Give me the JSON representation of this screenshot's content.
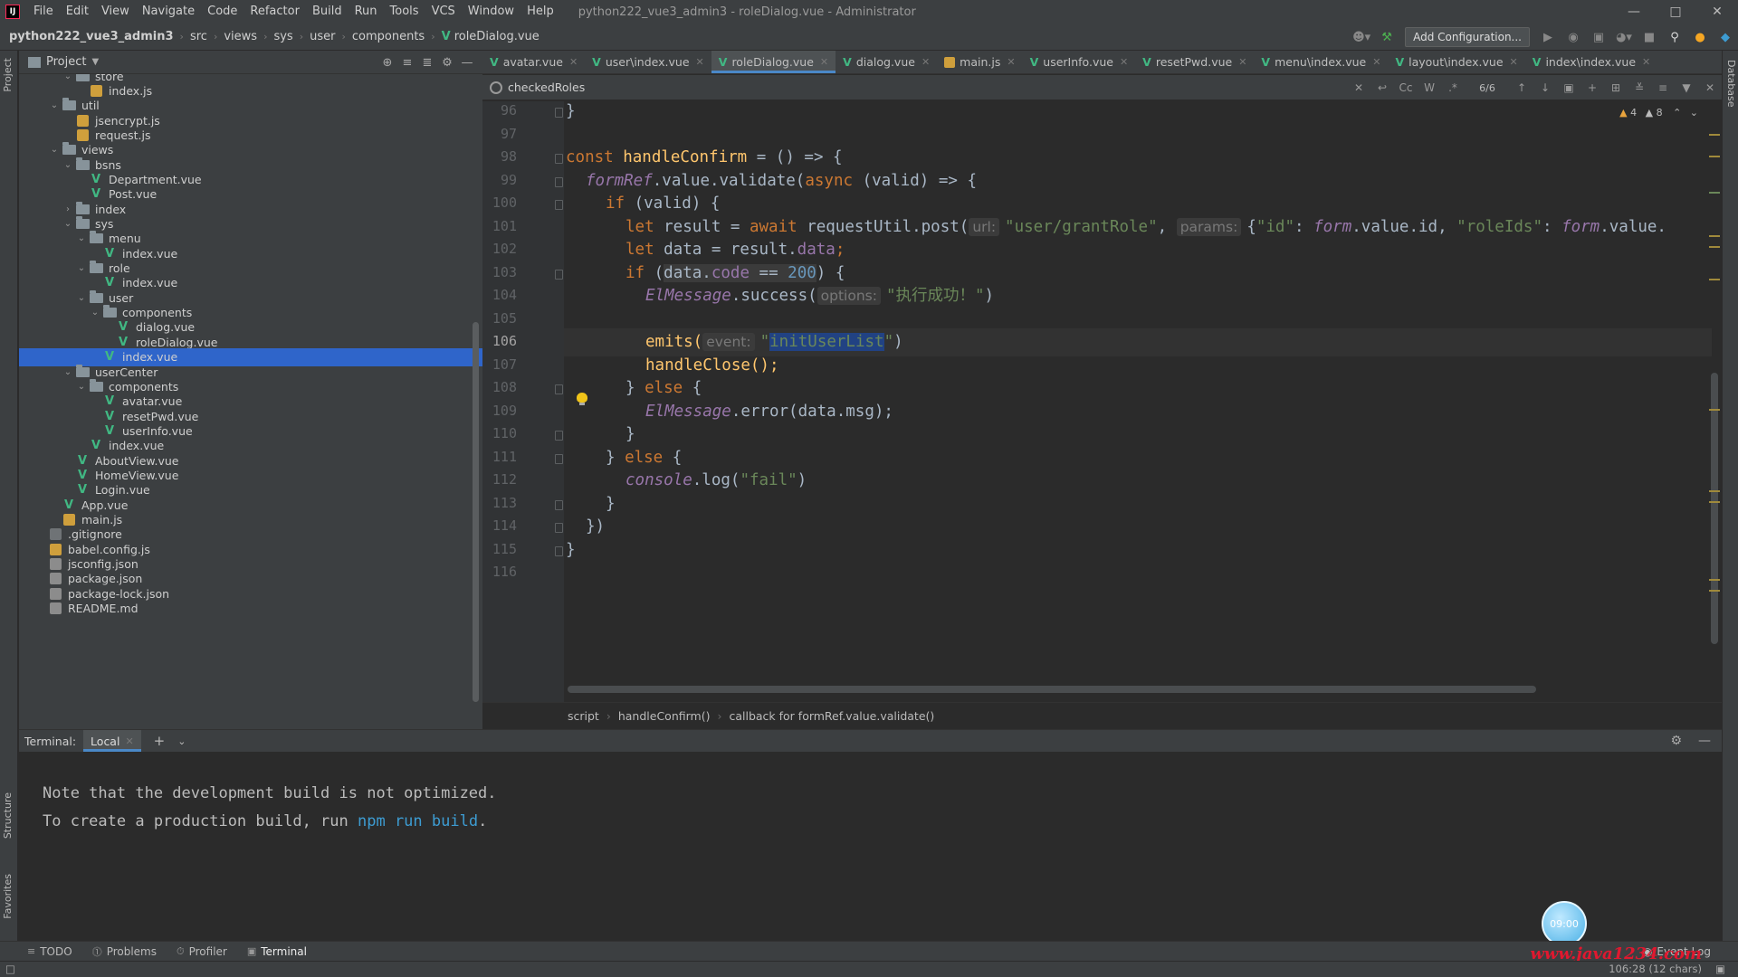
{
  "window": {
    "title": "python222_vue3_admin3 - roleDialog.vue - Administrator",
    "menu": [
      "File",
      "Edit",
      "View",
      "Navigate",
      "Code",
      "Refactor",
      "Build",
      "Run",
      "Tools",
      "VCS",
      "Window",
      "Help"
    ]
  },
  "breadcrumb": [
    "python222_vue3_admin3",
    "src",
    "views",
    "sys",
    "user",
    "components",
    "roleDialog.vue"
  ],
  "toolbar": {
    "add_configuration": "Add Configuration..."
  },
  "project": {
    "title": "Project",
    "tree": [
      {
        "label": "store",
        "type": "folder",
        "depth": 3,
        "open": true
      },
      {
        "label": "index.js",
        "type": "js",
        "depth": 4
      },
      {
        "label": "util",
        "type": "folder",
        "depth": 2,
        "open": true
      },
      {
        "label": "jsencrypt.js",
        "type": "js",
        "depth": 3
      },
      {
        "label": "request.js",
        "type": "js",
        "depth": 3
      },
      {
        "label": "views",
        "type": "folder",
        "depth": 2,
        "open": true
      },
      {
        "label": "bsns",
        "type": "folder",
        "depth": 3,
        "open": true
      },
      {
        "label": "Department.vue",
        "type": "vue",
        "depth": 4
      },
      {
        "label": "Post.vue",
        "type": "vue",
        "depth": 4
      },
      {
        "label": "index",
        "type": "folder",
        "depth": 3,
        "open": false
      },
      {
        "label": "sys",
        "type": "folder",
        "depth": 3,
        "open": true
      },
      {
        "label": "menu",
        "type": "folder",
        "depth": 4,
        "open": true
      },
      {
        "label": "index.vue",
        "type": "vue",
        "depth": 5
      },
      {
        "label": "role",
        "type": "folder",
        "depth": 4,
        "open": true
      },
      {
        "label": "index.vue",
        "type": "vue",
        "depth": 5
      },
      {
        "label": "user",
        "type": "folder",
        "depth": 4,
        "open": true
      },
      {
        "label": "components",
        "type": "folder",
        "depth": 5,
        "open": true
      },
      {
        "label": "dialog.vue",
        "type": "vue",
        "depth": 6
      },
      {
        "label": "roleDialog.vue",
        "type": "vue",
        "depth": 6
      },
      {
        "label": "index.vue",
        "type": "vue",
        "depth": 5,
        "selected": true
      },
      {
        "label": "userCenter",
        "type": "folder",
        "depth": 3,
        "open": true
      },
      {
        "label": "components",
        "type": "folder",
        "depth": 4,
        "open": true
      },
      {
        "label": "avatar.vue",
        "type": "vue",
        "depth": 5
      },
      {
        "label": "resetPwd.vue",
        "type": "vue",
        "depth": 5
      },
      {
        "label": "userInfo.vue",
        "type": "vue",
        "depth": 5
      },
      {
        "label": "index.vue",
        "type": "vue",
        "depth": 4
      },
      {
        "label": "AboutView.vue",
        "type": "vue",
        "depth": 3
      },
      {
        "label": "HomeView.vue",
        "type": "vue",
        "depth": 3
      },
      {
        "label": "Login.vue",
        "type": "vue",
        "depth": 3
      },
      {
        "label": "App.vue",
        "type": "vue",
        "depth": 2
      },
      {
        "label": "main.js",
        "type": "js",
        "depth": 2
      },
      {
        "label": ".gitignore",
        "type": "git",
        "depth": 1
      },
      {
        "label": "babel.config.js",
        "type": "js",
        "depth": 1
      },
      {
        "label": "jsconfig.json",
        "type": "json",
        "depth": 1
      },
      {
        "label": "package.json",
        "type": "json",
        "depth": 1
      },
      {
        "label": "package-lock.json",
        "type": "json",
        "depth": 1
      },
      {
        "label": "README.md",
        "type": "json",
        "depth": 1
      }
    ]
  },
  "tabs": [
    {
      "label": "avatar.vue",
      "type": "vue"
    },
    {
      "label": "user\\index.vue",
      "type": "vue"
    },
    {
      "label": "roleDialog.vue",
      "type": "vue",
      "active": true
    },
    {
      "label": "dialog.vue",
      "type": "vue"
    },
    {
      "label": "main.js",
      "type": "js"
    },
    {
      "label": "userInfo.vue",
      "type": "vue"
    },
    {
      "label": "resetPwd.vue",
      "type": "vue"
    },
    {
      "label": "menu\\index.vue",
      "type": "vue"
    },
    {
      "label": "layout\\index.vue",
      "type": "vue"
    },
    {
      "label": "index\\index.vue",
      "type": "vue"
    }
  ],
  "search": {
    "value": "checkedRoles",
    "match_count": "6/6"
  },
  "inspections": {
    "warnings": "4",
    "weak_warnings": "8"
  },
  "editor": {
    "current_line": "106",
    "lines": [
      {
        "n": "96"
      },
      {
        "n": "97"
      },
      {
        "n": "98"
      },
      {
        "n": "99"
      },
      {
        "n": "100"
      },
      {
        "n": "101"
      },
      {
        "n": "102"
      },
      {
        "n": "103"
      },
      {
        "n": "104"
      },
      {
        "n": "105"
      },
      {
        "n": "106"
      },
      {
        "n": "107"
      },
      {
        "n": "108"
      },
      {
        "n": "109"
      },
      {
        "n": "110"
      },
      {
        "n": "111"
      },
      {
        "n": "112"
      },
      {
        "n": "113"
      },
      {
        "n": "114"
      },
      {
        "n": "115"
      },
      {
        "n": "116"
      }
    ],
    "code": {
      "l98_const": "const ",
      "l98_fn": "handleConfirm",
      "l98_rest": " = () => {",
      "l99_form": "formRef",
      "l99_value": ".value",
      "l99_validate": ".validate(",
      "l99_async": "async",
      "l99_rest": " (valid) => {",
      "l100_if": "if",
      "l100_rest": " (valid) {",
      "l101_let": "let",
      "l101_a": " result = ",
      "l101_await": "await",
      "l101_b": " requestUtil.post(",
      "l101_hint_url": "url:",
      "l101_str1": "\"user/grantRole\"",
      "l101_comma": ", ",
      "l101_hint_params": "params:",
      "l101_brace": "{",
      "l101_key1": "\"id\"",
      "l101_c": ": ",
      "l101_form1": "form",
      "l101_d": ".value.id, ",
      "l101_key2": "\"roleIds\"",
      "l101_e": ": ",
      "l101_form2": "form",
      "l101_f": ".value.",
      "l102_let": "let",
      "l102_a": " data = result.",
      "l102_data": "data",
      "l102_b": ";",
      "l103_if": "if",
      "l103_a": " (",
      "l103_cond_a": "data.",
      "l103_cond_code": "code",
      "l103_cond_b": " == ",
      "l103_cond_num": "200",
      "l103_b": ") {",
      "l104_el": "ElMessage",
      "l104_a": ".success(",
      "l104_hint": "options:",
      "l104_str": "\"执行成功！\"",
      "l104_b": ")",
      "l106_emits": "emits(",
      "l106_hint": "event:",
      "l106_q1": "\"",
      "l106_sel": "initUserList",
      "l106_q2": "\"",
      "l106_b": ")",
      "l107": "handleClose();",
      "l108_a": "} ",
      "l108_else": "else",
      "l108_b": " {",
      "l109_el": "ElMessage",
      "l109_a": ".error(data.msg);",
      "l110": "}",
      "l111_a": "} ",
      "l111_else": "else",
      "l111_b": " {",
      "l112_console": "console",
      "l112_a": ".log(",
      "l112_str": "\"fail\"",
      "l112_b": ")",
      "l113": "}",
      "l114": "})",
      "l115": "}",
      "l96": "}"
    }
  },
  "code_breadcrumbs": [
    "script",
    "handleConfirm()",
    "callback for formRef.value.validate()"
  ],
  "terminal": {
    "label": "Terminal:",
    "tab": "Local",
    "line1": "Note that the development build is not optimized.",
    "line2_a": "To create a production build, run ",
    "line2_link": "npm run build",
    "line2_b": ".",
    "timer": "09:00"
  },
  "toolwindows": [
    "TODO",
    "Problems",
    "Profiler",
    "Terminal"
  ],
  "event_log": "Event Log",
  "status": {
    "position": "106:28 (12 chars)"
  },
  "stripe": {
    "left_top": "Project",
    "left_structure": "Structure",
    "left_favorites": "Favorites",
    "right": "Database"
  },
  "watermark": "www.java1234.com"
}
